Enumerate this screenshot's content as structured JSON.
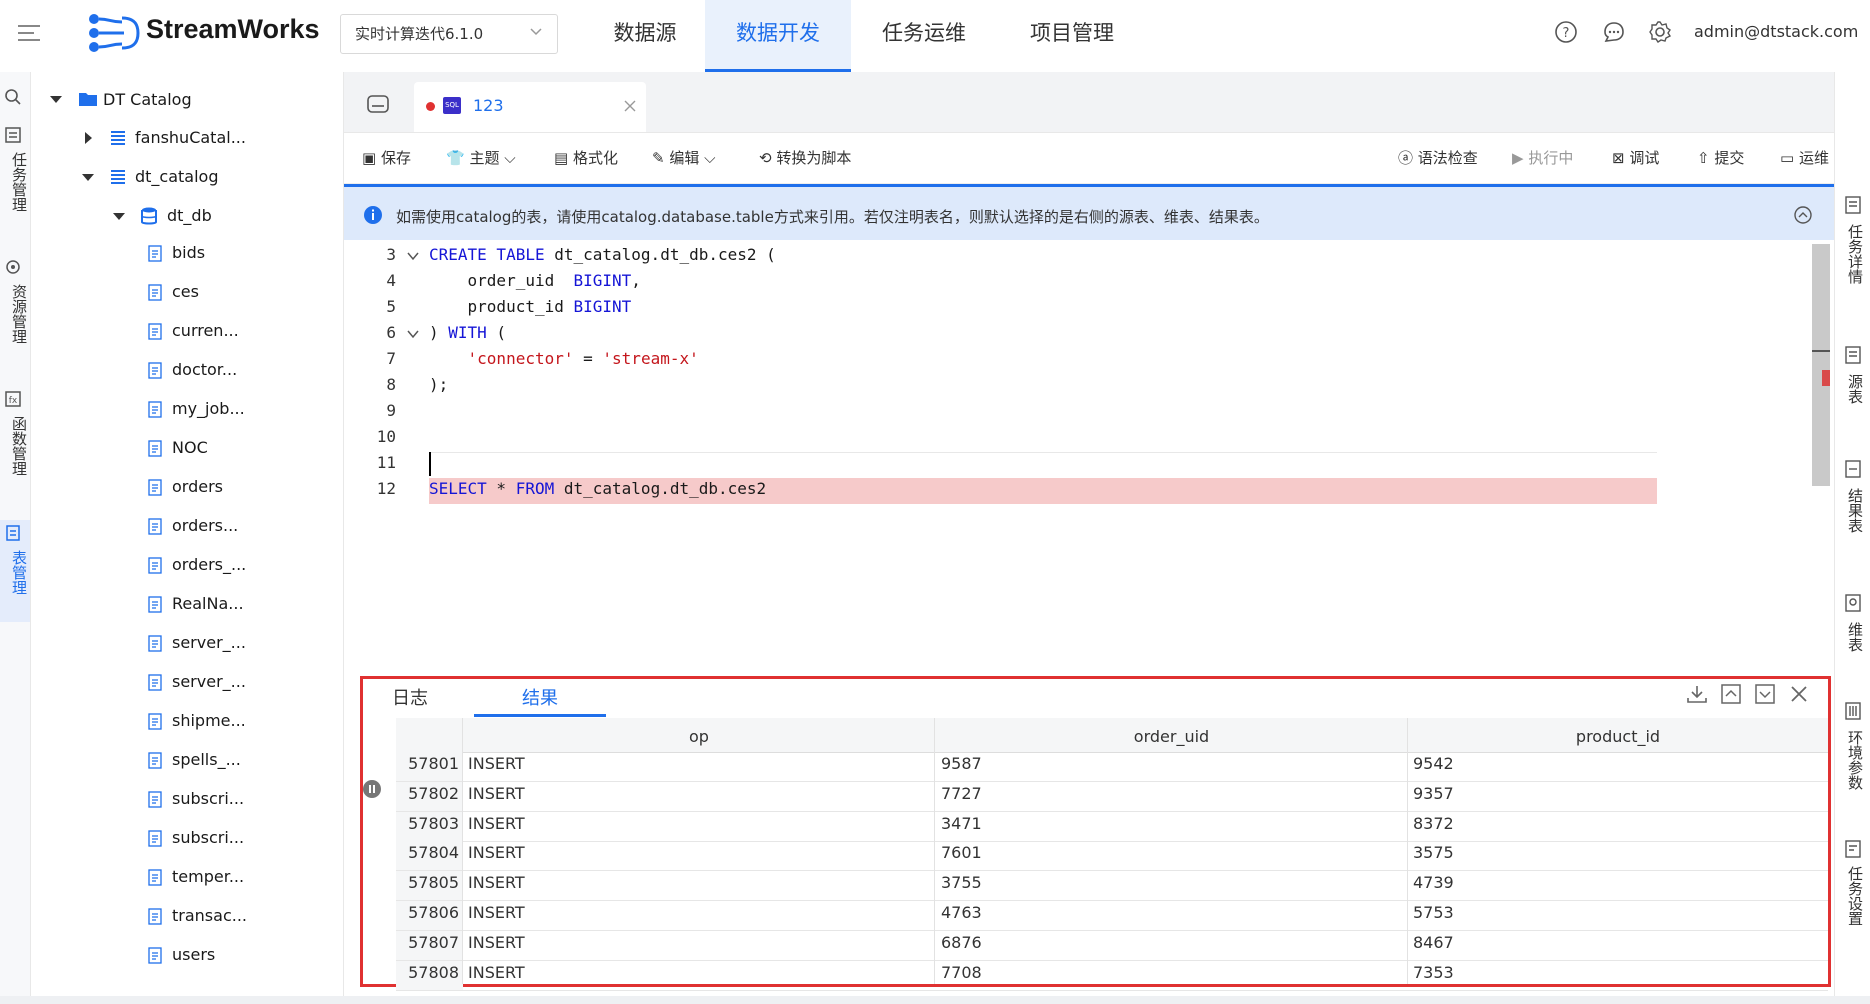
{
  "header": {
    "brand": "StreamWorks",
    "project_select": "实时计算迭代6.1.0",
    "nav": [
      "数据源",
      "数据开发",
      "任务运维",
      "项目管理"
    ],
    "active_nav": "数据开发",
    "user": "admin@dtstack.com"
  },
  "left_rail": {
    "items": [
      "任务管理",
      "资源管理",
      "函数管理",
      "表管理"
    ],
    "active": "表管理"
  },
  "tree": {
    "root": "DT Catalog",
    "catalogs": [
      "fanshuCatal...",
      "dt_catalog"
    ],
    "db": "dt_db",
    "tables": [
      "bids",
      "ces",
      "curren...",
      "doctor...",
      "my_job...",
      "NOC",
      "orders",
      "orders...",
      "orders_...",
      "RealNa...",
      "server_...",
      "server_...",
      "shipme...",
      "spells_...",
      "subscri...",
      "subscri...",
      "temper...",
      "transac...",
      "users"
    ]
  },
  "editor_tab": {
    "badge": "SQL",
    "name": "123"
  },
  "toolbar": {
    "save": "保存",
    "theme": "主题",
    "format": "格式化",
    "edit": "编辑",
    "convert": "转换为脚本",
    "syntax_check": "语法检查",
    "running": "执行中",
    "debug": "调试",
    "submit": "提交",
    "ops": "运维"
  },
  "info_banner": "如需使用catalog的表，请使用catalog.database.table方式来引用。若仅注明表名，则默认选择的是右侧的源表、维表、结果表。",
  "code": {
    "line_numbers": [
      "3",
      "4",
      "5",
      "6",
      "7",
      "8",
      "9",
      "10",
      "11",
      "12"
    ],
    "l3_kw": "CREATE TABLE",
    "l3_rest": " dt_catalog.dt_db.ces2 (",
    "l4_a": "    order_uid  ",
    "l4_kw": "BIGINT",
    "l4_b": ",",
    "l5_a": "    product_id ",
    "l5_kw": "BIGINT",
    "l6_a": ") ",
    "l6_kw": "WITH",
    "l6_b": " (",
    "l7_a": "    ",
    "l7_s1": "'connector'",
    "l7_b": " = ",
    "l7_s2": "'stream-x'",
    "l8": ");",
    "l12_kw1": "SELECT",
    "l12_b": " * ",
    "l12_kw2": "FROM",
    "l12_c": " dt_catalog.dt_db.ces2"
  },
  "results": {
    "tabs": [
      "日志",
      "结果"
    ],
    "active_tab": "结果",
    "columns": [
      "op",
      "order_uid",
      "product_id"
    ],
    "rows": [
      {
        "idx": "57801",
        "op": "INSERT",
        "order_uid": "9587",
        "product_id": "9542"
      },
      {
        "idx": "57802",
        "op": "INSERT",
        "order_uid": "7727",
        "product_id": "9357"
      },
      {
        "idx": "57803",
        "op": "INSERT",
        "order_uid": "3471",
        "product_id": "8372"
      },
      {
        "idx": "57804",
        "op": "INSERT",
        "order_uid": "7601",
        "product_id": "3575"
      },
      {
        "idx": "57805",
        "op": "INSERT",
        "order_uid": "3755",
        "product_id": "4739"
      },
      {
        "idx": "57806",
        "op": "INSERT",
        "order_uid": "4763",
        "product_id": "5753"
      },
      {
        "idx": "57807",
        "op": "INSERT",
        "order_uid": "6876",
        "product_id": "8467"
      },
      {
        "idx": "57808",
        "op": "INSERT",
        "order_uid": "7708",
        "product_id": "7353"
      }
    ]
  },
  "right_rail": [
    "任务详情",
    "源表",
    "结果表",
    "维表",
    "环境参数",
    "任务设置"
  ],
  "colors": {
    "accent": "#1f6feb",
    "error_line": "#f6caca",
    "highlight_border": "#e03131"
  }
}
